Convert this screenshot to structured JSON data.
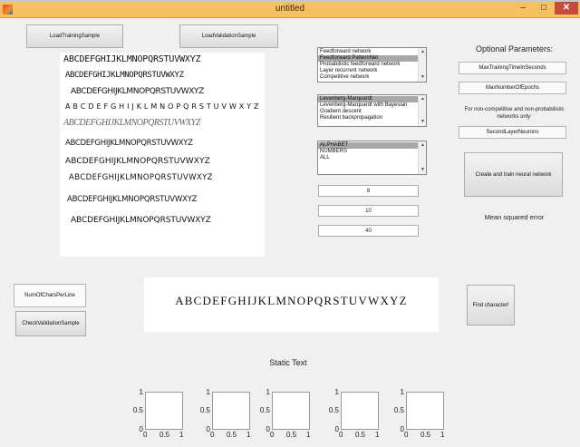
{
  "window": {
    "title": "untitled",
    "minimize": "–",
    "maximize": "□",
    "close": "✕"
  },
  "buttons": {
    "load_training": "LoadTrainingSample",
    "load_validation": "LoadValidationSample",
    "num_chars_per_line": "NumOfCharsPerLine",
    "check_validation": "CheckValidationSample",
    "find_character": "Find character!",
    "create_train": "Create and train neural network",
    "max_training_time": "MaxTrainingTimeInSeconds",
    "max_epochs": "MaxNumberOfEpochs",
    "second_layer_neurons": "SecondLayerNeurons"
  },
  "training_sample_lines": [
    "ABCDEFGHIJKLMNOPQRSTUVWXYZ",
    "ABCDEFGHIJKLMNOPQRSTUVWXYZ",
    "ABCDEFGHIJKLMNOPQRSTUVWXYZ",
    "A B C D E F G H I J K L M N O P Q R S T U V W X Y Z",
    "ABCDEFGHIJKLMNOPQRSTUVWXYZ",
    "ABCDEFGHIJKLMNOPQRSTUVWXYZ",
    "ABCDEFGHIJKLMNOPQRSTUVWXYZ",
    "ABCDEFGHIJKLMNOPQRSTUVWXYZ",
    "ABCDEFGHIJKLMNOPQRSTUVWXYZ",
    "ABCDEFGHIJKLMNOPQRSTUVWXYZ"
  ],
  "network_types": [
    "Feedforward network",
    "Feedforward PatternNet",
    "Probabilistic feedforward network",
    "Layer recurrent network",
    "Competitive network"
  ],
  "training_algorithms": [
    "Levenberg-Marquardt",
    "Levenberg-Marquardt with Bayesian",
    "Gradient descent",
    "Resilient backpropagation"
  ],
  "character_sets": [
    "ALPHABET",
    "NUMBERS",
    "ALL"
  ],
  "edit_values": {
    "first": "8",
    "second": "10",
    "third": "40"
  },
  "labels": {
    "optional_parameters": "Optional Parameters:",
    "non_competitive_note": "For non-competitive and non-probabilistic networks only:",
    "mean_squared_error": "Mean squared error",
    "static_text": "Static Text"
  },
  "validation_text": "ABCDEFGHIJKLMNOPQRSTUVWXYZ",
  "plots": {
    "count": 5,
    "y_ticks": [
      "1",
      "0.5",
      "0"
    ],
    "x_ticks": [
      "0",
      "0.5",
      "1"
    ]
  }
}
